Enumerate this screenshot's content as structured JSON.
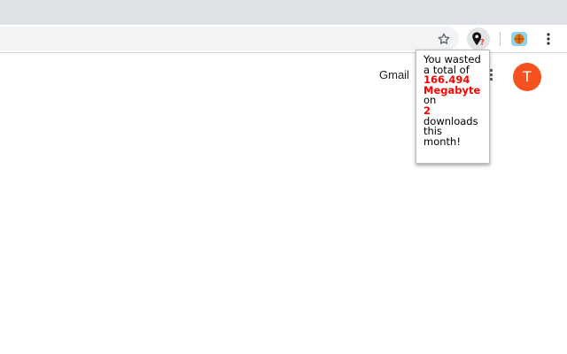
{
  "browser": {
    "toolbar": {
      "bookmark_icon": "star-icon",
      "extension_icon": "location-pin-question-icon",
      "extension2_icon": "basketball-icon",
      "menu_icon": "three-dots-vertical-icon"
    }
  },
  "page": {
    "gmail_label": "Gmail",
    "apps_icon": "grid-icon",
    "avatar_initial": "T",
    "avatar_color": "#f4511e"
  },
  "popup": {
    "line1": "You wasted",
    "line2": "a total of",
    "amount": "166.494",
    "unit": "Megabyte",
    "on": "on",
    "count": "2",
    "downloads": "downloads",
    "this": "this",
    "month": "month!",
    "highlight_color": "#ff0000"
  }
}
